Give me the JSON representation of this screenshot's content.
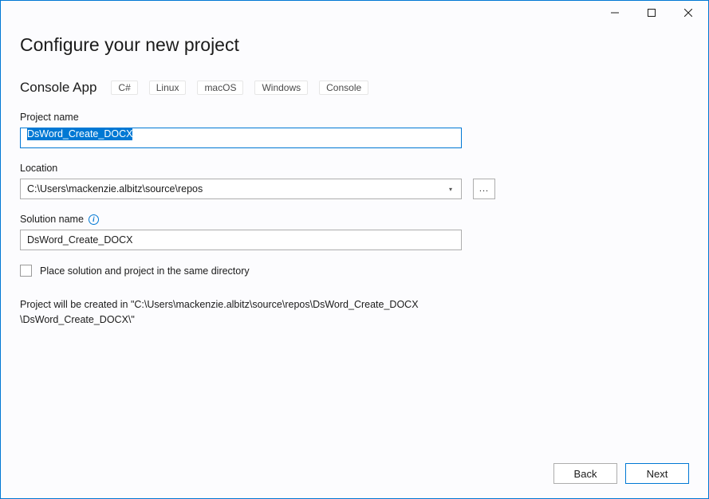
{
  "window": {
    "title": "Configure your new project",
    "subtitle": "Console App",
    "tags": [
      "C#",
      "Linux",
      "macOS",
      "Windows",
      "Console"
    ]
  },
  "form": {
    "projectName": {
      "label": "Project name",
      "value": "DsWord_Create_DOCX"
    },
    "location": {
      "label": "Location",
      "value": "C:\\Users\\mackenzie.albitz\\source\\repos",
      "browse_label": "..."
    },
    "solutionName": {
      "label": "Solution name",
      "value": "DsWord_Create_DOCX"
    },
    "sameDir": {
      "label": "Place solution and project in the same directory",
      "checked": false
    },
    "pathHint": "Project will be created in \"C:\\Users\\mackenzie.albitz\\source\\repos\\DsWord_Create_DOCX\\DsWord_Create_DOCX\\\""
  },
  "footer": {
    "back": "Back",
    "next": "Next"
  }
}
